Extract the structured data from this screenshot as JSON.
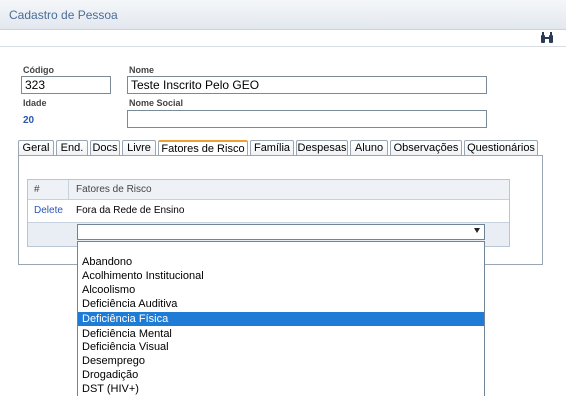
{
  "window": {
    "title": "Cadastro de Pessoa"
  },
  "toolbar": {
    "find_icon": "binoculars-icon"
  },
  "form": {
    "codigo_label": "Código",
    "codigo_value": "323",
    "nome_label": "Nome",
    "nome_value": "Teste Inscrito Pelo GEO",
    "idade_label": "Idade",
    "idade_value": "20",
    "nome_social_label": "Nome Social",
    "nome_social_value": ""
  },
  "tabs": [
    {
      "label": "Geral"
    },
    {
      "label": "End."
    },
    {
      "label": "Docs"
    },
    {
      "label": "Livre"
    },
    {
      "label": "Fatores de Risco",
      "active": true
    },
    {
      "label": "Família"
    },
    {
      "label": "Despesas"
    },
    {
      "label": "Aluno"
    },
    {
      "label": "Observações"
    },
    {
      "label": "Questionários"
    }
  ],
  "grid": {
    "col_hash": "#",
    "col_fatores": "Fatores de Risco",
    "rows": [
      {
        "action": "Delete",
        "value": "Fora da Rede de Ensino"
      }
    ]
  },
  "select": {
    "value": "",
    "options": [
      "Abandono",
      "Acolhimento Institucional",
      "Alcoolismo",
      "Deficiência Auditiva",
      "Deficiência Física",
      "Deficiência Mental",
      "Deficiência Visual",
      "Desemprego",
      "Drogadição",
      "DST (HIV+)"
    ],
    "highlighted": "Deficiência Física"
  },
  "colors": {
    "accent": "#f0a030",
    "highlight": "#1e7bd6",
    "link": "#2a55b5"
  }
}
